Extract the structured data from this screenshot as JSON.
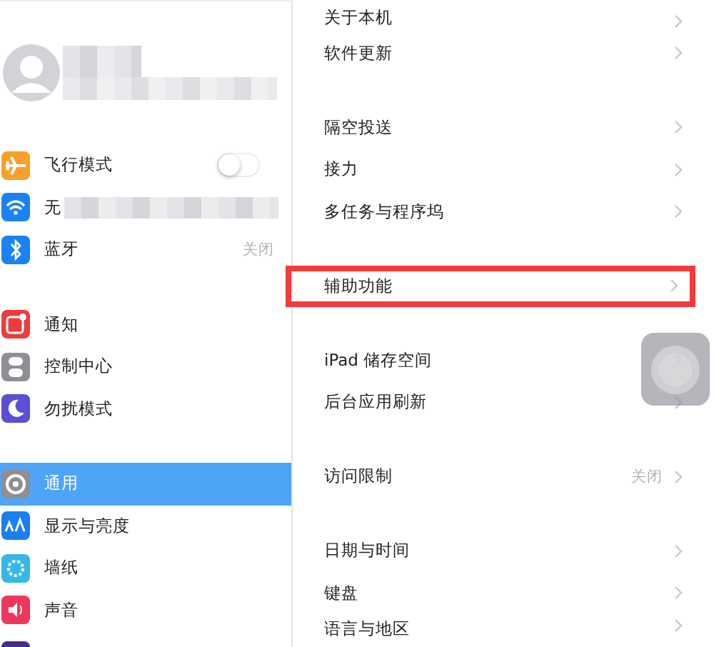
{
  "sidebar": {
    "profile": {
      "kind": "blurred"
    },
    "groups": [
      [
        {
          "kind": "toggle",
          "label": "飞行模式",
          "color": "#f7a02a",
          "on": false,
          "selected": false
        },
        {
          "kind": "blurred",
          "label": "无",
          "color": "#1a82f7",
          "selected": false
        },
        {
          "kind": "value",
          "label": "蓝牙",
          "value": "关闭",
          "color": "#1a82f7",
          "selected": false
        }
      ],
      [
        {
          "kind": "plain",
          "label": "通知",
          "color": "#f03b3b",
          "selected": false
        },
        {
          "kind": "plain",
          "label": "控制中心",
          "color": "#8e8e93",
          "selected": false
        },
        {
          "kind": "plain",
          "label": "勿扰模式",
          "color": "#5b4fd6",
          "selected": false
        }
      ],
      [
        {
          "kind": "plain",
          "label": "通用",
          "color": "#8e8e93",
          "selected": true
        },
        {
          "kind": "plain",
          "label": "显示与亮度",
          "color": "#1a7ff0",
          "selected": false
        },
        {
          "kind": "plain",
          "label": "墙纸",
          "color": "#35b8e8",
          "selected": false
        },
        {
          "kind": "plain",
          "label": "声音",
          "color": "#f0365a",
          "selected": false
        },
        {
          "kind": "partial",
          "color": "#4a2a8a",
          "selected": false
        }
      ]
    ]
  },
  "detail": {
    "groups": [
      [
        {
          "label": "关于本机",
          "highlighted": false
        },
        {
          "label": "软件更新",
          "highlighted": false
        }
      ],
      [
        {
          "label": "隔空投送",
          "highlighted": false
        },
        {
          "label": "接力",
          "highlighted": false
        },
        {
          "label": "多任务与程序坞",
          "highlighted": false
        }
      ],
      [
        {
          "label": "辅助功能",
          "highlighted": true
        }
      ],
      [
        {
          "label": "iPad 储存空间",
          "highlighted": false
        },
        {
          "label": "后台应用刷新",
          "highlighted": false
        }
      ],
      [
        {
          "label": "访问限制",
          "value": "关闭",
          "highlighted": false
        }
      ],
      [
        {
          "label": "日期与时间",
          "highlighted": false
        },
        {
          "label": "键盘",
          "highlighted": false
        },
        {
          "label": "语言与地区",
          "highlighted": false
        }
      ]
    ]
  }
}
